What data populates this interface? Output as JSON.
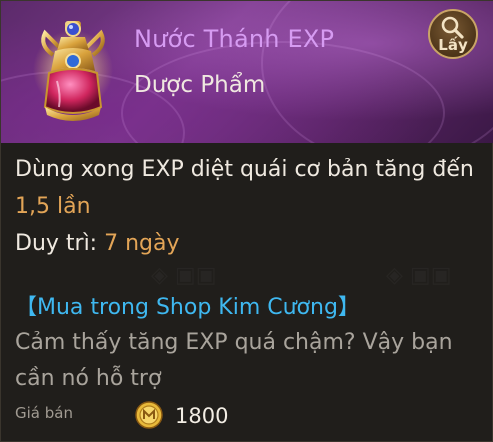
{
  "item": {
    "name": "Nước Thánh EXP",
    "type": "Dược Phẩm",
    "get_button_label": "Lấy"
  },
  "description": {
    "line1": "Dùng xong EXP diệt quái cơ bản tăng đến",
    "multiplier": "1,5 lần",
    "duration_label": "Duy trì: ",
    "duration_value": "7 ngày"
  },
  "shop": {
    "title": "【Mua trong Shop Kim Cương】",
    "description": "Cảm thấy tăng EXP quá chậm? Vậy bạn cần nó hỗ trợ"
  },
  "price": {
    "label": "Giá bán",
    "value": "1800"
  },
  "colors": {
    "item_name": "#d69bf2",
    "accent": "#e3a557",
    "shop_link": "#3fb8f0",
    "header_bg": "#6b3179",
    "panel_bg": "#201e1b"
  },
  "icons": {
    "item": "holy-water-potion-icon",
    "get": "magnifier-icon",
    "currency": "gold-coin-icon"
  }
}
